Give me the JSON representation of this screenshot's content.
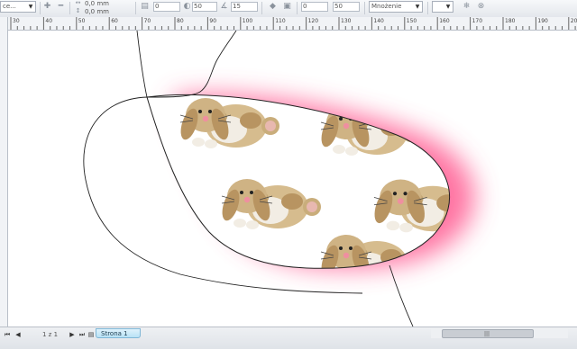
{
  "toolbar": {
    "style_dropdown": "ce...",
    "offset_x": "0,0 mm",
    "offset_y": "0,0 mm",
    "field_a": "0",
    "field_b": "50",
    "field_c": "15",
    "field_d": "0",
    "field_e": "50",
    "merge_mode": "Mnożenie"
  },
  "ruler": {
    "labels": [
      "30",
      "40",
      "50",
      "60",
      "70",
      "80",
      "90",
      "100",
      "110",
      "120",
      "130",
      "140",
      "150",
      "160",
      "170",
      "180",
      "190",
      "200"
    ]
  },
  "status": {
    "page_count": "1 z 1",
    "page_tab": "Strona 1"
  },
  "colors": {
    "glow": "#ff6f9c",
    "bunny_fur": "#c9ad7b",
    "bunny_dark": "#a88752",
    "ear_pink": "#e8a0a8",
    "outline": "#333333"
  }
}
